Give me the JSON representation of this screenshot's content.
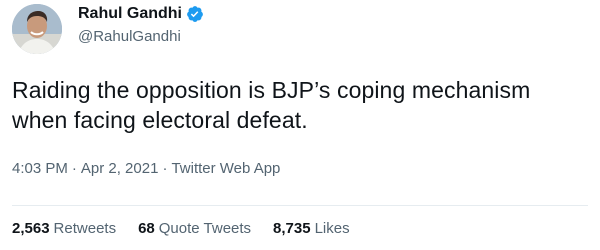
{
  "author": {
    "name": "Rahul Gandhi",
    "handle": "@RahulGandhi",
    "verified": true
  },
  "tweet": {
    "text_line1": "Raiding the opposition is BJP’s coping mechanism",
    "text_line2": "when facing electoral defeat."
  },
  "meta": {
    "time": "4:03 PM",
    "separator1": "·",
    "date": "Apr 2, 2021",
    "separator2": "·",
    "source": "Twitter Web App"
  },
  "stats": {
    "retweets_count": "2,563",
    "retweets_label": "Retweets",
    "quotes_count": "68",
    "quotes_label": "Quote Tweets",
    "likes_count": "8,735",
    "likes_label": "Likes"
  },
  "colors": {
    "verified_badge": "#1d9bf0",
    "secondary_text": "#536471",
    "primary_text": "#0f1419"
  }
}
